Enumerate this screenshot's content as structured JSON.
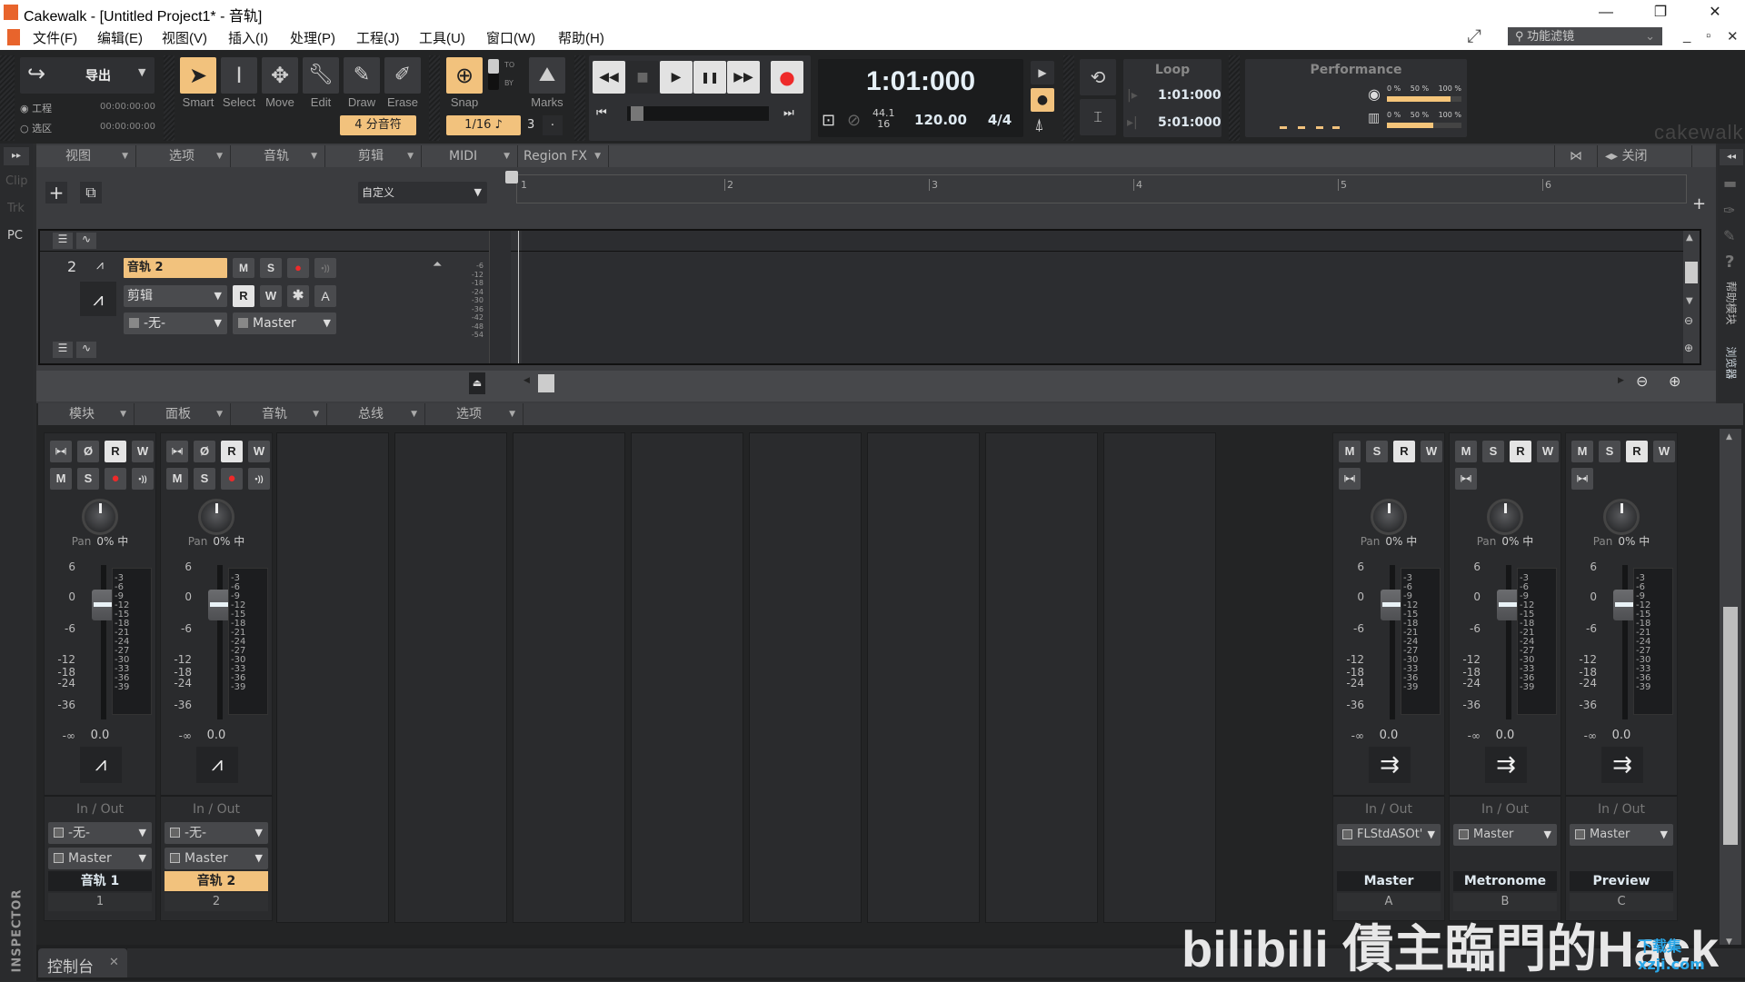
{
  "window": {
    "title": "Cakewalk - [Untitled Project1* - 音轨]",
    "minimize": "—",
    "restore": "❐",
    "close": "✕"
  },
  "menubar": {
    "items": [
      "文件(F)",
      "编辑(E)",
      "视图(V)",
      "插入(I)",
      "处理(P)",
      "工程(J)",
      "工具(U)",
      "窗口(W)",
      "帮助(H)"
    ],
    "feature_filter": "功能滤镜",
    "mdi_min": "_",
    "mdi_restore": "▫",
    "mdi_close": "✕"
  },
  "control_bar": {
    "export": {
      "label": "导出",
      "radio_project": "工程",
      "radio_selection": "选区",
      "time_project": "00:00:00:00",
      "time_selection": "00:00:00:00"
    },
    "tools": [
      {
        "label": "Smart",
        "icon": "smart-cursor-icon",
        "active": true
      },
      {
        "label": "Select",
        "icon": "i-beam-icon",
        "active": false
      },
      {
        "label": "Move",
        "icon": "move-arrows-icon",
        "active": false
      },
      {
        "label": "Edit",
        "icon": "wrench-icon",
        "active": false
      },
      {
        "label": "Draw",
        "icon": "pencil-icon",
        "active": false
      },
      {
        "label": "Erase",
        "icon": "eraser-icon",
        "active": false
      }
    ],
    "note_duration": "4 分音符",
    "snap": {
      "label": "Snap",
      "to": "TO",
      "by": "BY",
      "value": "1/16",
      "marks_label": "Marks",
      "marks_count": "3",
      "dot": "."
    },
    "transport": {
      "rewind": "◀◀",
      "stop": "■",
      "play": "▶",
      "pause": "❚❚",
      "ffwd": "▶▶",
      "go_start": "⏮",
      "go_end": "⏭",
      "time": "1:01:000",
      "sample_rate": "44.1",
      "bit_depth": "16",
      "tempo": "120.00",
      "meter": "4/4"
    },
    "loop": {
      "label": "Loop",
      "start": "1:01:000",
      "end": "5:01:000"
    },
    "performance": {
      "label": "Performance",
      "scale": [
        "0 %",
        "50 %",
        "100 %"
      ],
      "disk_load": 0.85,
      "cpu_load": 0.62
    },
    "brand": "cakewalk"
  },
  "left_rail": {
    "items": [
      "Clip",
      "Trk",
      "PC"
    ],
    "inspector": "INSPECTOR",
    "expand": "▸▸"
  },
  "track_view": {
    "menus": [
      {
        "label": "视图"
      },
      {
        "label": "选项"
      },
      {
        "label": "音轨"
      },
      {
        "label": "剪辑"
      },
      {
        "label": "MIDI"
      },
      {
        "label": "Region FX"
      }
    ],
    "right_menu": "关闭",
    "preset": "自定义",
    "ruler": [
      "1",
      "2",
      "3",
      "4",
      "5",
      "6"
    ],
    "track": {
      "number": "2",
      "name": "音轨 2",
      "mute": "M",
      "solo": "S",
      "arm": "●",
      "echo": "•))",
      "edit_mode": "剪辑",
      "read": "R",
      "write": "W",
      "fx": "✱",
      "archive": "A",
      "input": "-无-",
      "output": "Master",
      "meter_scale": [
        "-6",
        "-12",
        "-18",
        "-24",
        "-30",
        "-36",
        "-42",
        "-48",
        "-54"
      ]
    }
  },
  "console": {
    "menus": [
      {
        "label": "模块"
      },
      {
        "label": "面板"
      },
      {
        "label": "音轨"
      },
      {
        "label": "总线"
      },
      {
        "label": "选项"
      }
    ],
    "pan_label": "Pan",
    "pan_value": "0% 中",
    "io_label": "In / Out",
    "fader_scale": [
      "6",
      "0",
      "-6",
      "-12",
      "-18",
      "-24",
      "-36",
      "-∞"
    ],
    "meter_scale": [
      "-3",
      "-6",
      "-9",
      "-12",
      "-15",
      "-18",
      "-21",
      "-24",
      "-27",
      "-30",
      "-33",
      "-36",
      "-39"
    ],
    "tracks": [
      {
        "name": "音轨 1",
        "number": "1",
        "volume": "0.0",
        "input": "-无-",
        "output": "Master",
        "selected": false
      },
      {
        "name": "音轨 2",
        "number": "2",
        "volume": "0.0",
        "input": "-无-",
        "output": "Master",
        "selected": true
      }
    ],
    "buses": [
      {
        "name": "Master",
        "letter": "A",
        "volume": "0.0",
        "output": "FLStdASOt'"
      },
      {
        "name": "Metronome",
        "letter": "B",
        "volume": "0.0",
        "output": "Master"
      },
      {
        "name": "Preview",
        "letter": "C",
        "volume": "0.0",
        "output": "Master"
      }
    ],
    "btn": {
      "mute": "M",
      "solo": "S",
      "read": "R",
      "write": "W",
      "phase": "Ø",
      "arm": "●",
      "echo": "•))",
      "interleave": "|▸◂|"
    }
  },
  "right_rail": {
    "browser": "浏览器",
    "help": "帮助模块",
    "collapse": "◂◂"
  },
  "bottom": {
    "tab": "控制台",
    "close": "✕"
  },
  "watermark": {
    "text": "bilibili 債主臨門的Hack",
    "site": "下载集 xzji.com"
  }
}
